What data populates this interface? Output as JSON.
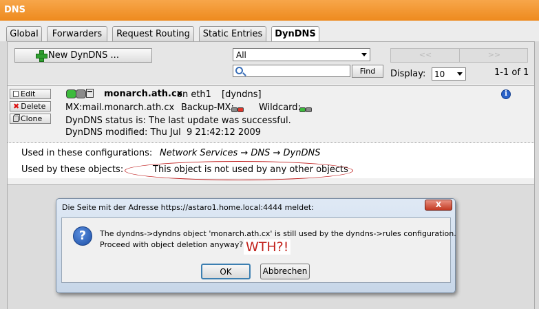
{
  "header": {
    "title": "DNS"
  },
  "tabs": [
    {
      "label": "Global"
    },
    {
      "label": "Forwarders"
    },
    {
      "label": "Request Routing"
    },
    {
      "label": "Static Entries"
    },
    {
      "label": "DynDNS"
    }
  ],
  "toolbar": {
    "new_button": "New DynDNS ...",
    "filter_value": "All",
    "search_placeholder": "",
    "find_button": "Find",
    "pager_prev": "<<",
    "pager_next": ">>",
    "display_label": "Display:",
    "display_value": "10",
    "count": "1-1 of 1"
  },
  "entry": {
    "buttons": {
      "edit": "Edit",
      "delete": "Delete",
      "clone": "Clone"
    },
    "hostname": "monarch.ath.cx",
    "interface": "on eth1",
    "type": "[dyndns]",
    "mx": "MX:mail.monarch.ath.cx",
    "backup_mx": "Backup-MX:",
    "wildcard": "Wildcard:",
    "status": "DynDNS status is: The last update was successful.",
    "modified": "DynDNS modified: Thu Jul  9 21:42:12 2009",
    "configs_label": "Used in these configurations:",
    "configs_value": "Network Services → DNS → DynDNS",
    "objects_label": "Used by these objects:",
    "objects_value": "This object is not used by any other objects"
  },
  "dialog": {
    "title": "Die Seite mit der Adresse https://astaro1.home.local:4444 meldet:",
    "close": "X",
    "message_line1": "The dyndns->dyndns object 'monarch.ath.cx' is still used by the dyndns->rules configuration.",
    "message_line2": "Proceed with object deletion anyway?",
    "annotation": "WTH?!",
    "ok": "OK",
    "cancel": "Abbrechen"
  },
  "colors": {
    "header_orange": "#ee8a1e",
    "status_green": "#3dbb3d",
    "status_gray": "#8a8a8a",
    "status_red": "#e0352a",
    "annotation_red": "#c2221c"
  }
}
